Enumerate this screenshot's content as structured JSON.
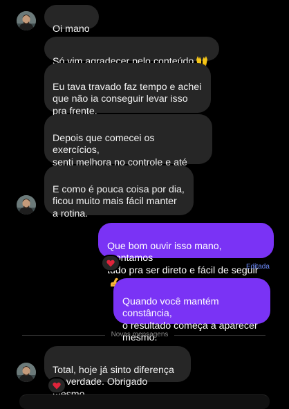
{
  "colors": {
    "background": "#000000",
    "incoming_bubble": "#262626",
    "outgoing_bubble": "#7a33f5",
    "edited_label": "#6f8dff"
  },
  "messages": [
    {
      "text": "Oi mano"
    },
    {
      "text": "Só vim agradecer pelo conteúdo",
      "icon": "raising-hands-icon"
    },
    {
      "text": "Eu tava travado faz tempo e achei\nque não ia conseguir levar isso\npra frente."
    },
    {
      "text": "Depois que comecei os exercícios,\nsenti melhora no controle e até\nna confiança."
    },
    {
      "text": "E como é pouca coisa por dia,\nficou muito mais fácil manter\na rotina."
    },
    {
      "text": "Que bom ouvir isso mano, montamos\ntudo pra ser direto e fácil de seguir",
      "icon": "flexed-biceps-icon",
      "reaction_icon": "red-heart-icon",
      "status": "Editada"
    },
    {
      "text": "Quando você mantém constância,\no resultado começa a aparecer\nmesmo."
    },
    {
      "text": "Total, hoje já sinto diferença\nde verdade. Obrigado mesmo.",
      "reaction_icon": "red-heart-icon"
    }
  ],
  "divider": {
    "label": "Novas mensagens"
  }
}
